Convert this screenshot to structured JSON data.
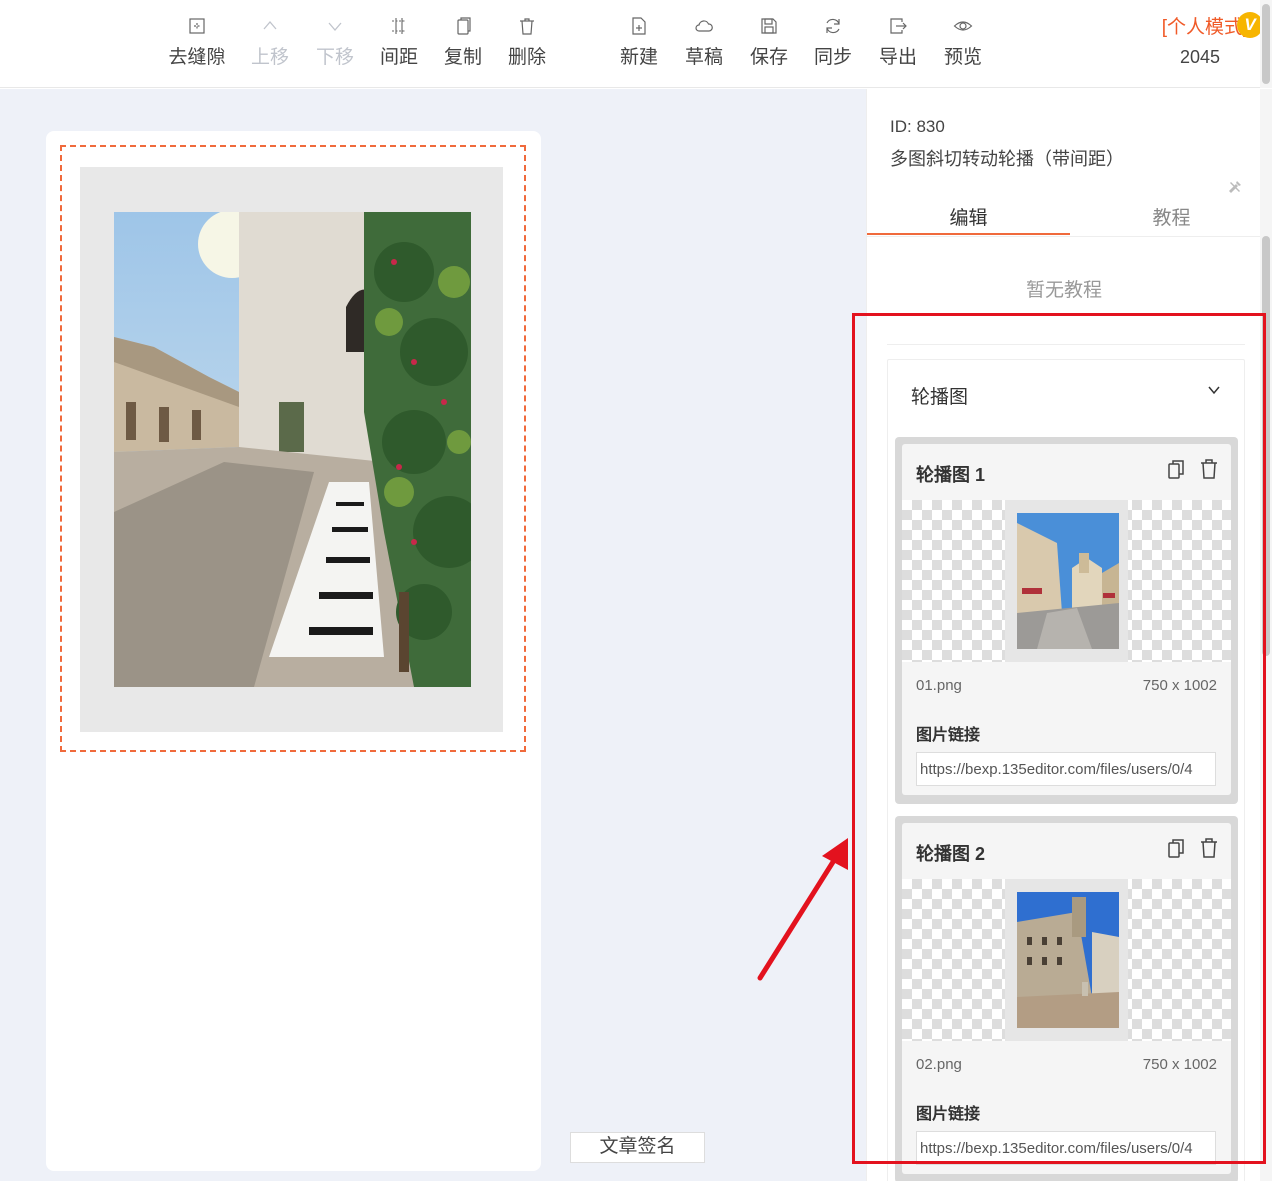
{
  "toolbar": {
    "items": [
      {
        "label": "去缝隙",
        "icon": "gap-icon",
        "enabled": true
      },
      {
        "label": "上移",
        "icon": "chevron-up-icon",
        "enabled": false
      },
      {
        "label": "下移",
        "icon": "chevron-down-icon",
        "enabled": false
      },
      {
        "label": "间距",
        "icon": "spacing-icon",
        "enabled": true
      },
      {
        "label": "复制",
        "icon": "copy-icon",
        "enabled": true
      },
      {
        "label": "删除",
        "icon": "trash-icon",
        "enabled": true
      },
      {
        "label": "新建",
        "icon": "new-file-icon",
        "enabled": true
      },
      {
        "label": "草稿",
        "icon": "cloud-icon",
        "enabled": true
      },
      {
        "label": "保存",
        "icon": "save-icon",
        "enabled": true
      },
      {
        "label": "同步",
        "icon": "sync-icon",
        "enabled": true
      },
      {
        "label": "导出",
        "icon": "export-icon",
        "enabled": true
      },
      {
        "label": "预览",
        "icon": "eye-icon",
        "enabled": true
      }
    ],
    "mode_label": "[个人模式]",
    "vip_badge": "V",
    "mode_count": "2045"
  },
  "document": {
    "signature_button": "文章签名"
  },
  "panel": {
    "id_text": "ID: 830",
    "template_name": "多图斜切转动轮播（带间距）",
    "tabs": [
      {
        "label": "编辑",
        "active": true
      },
      {
        "label": "教程",
        "active": false
      }
    ],
    "no_tutorial": "暂无教程",
    "carousel_group_title": "轮播图",
    "slides": [
      {
        "title": "轮播图 1",
        "file": "01.png",
        "dims": "750 x 1002",
        "link_label": "图片链接",
        "link_value": "https://bexp.135editor.com/files/users/0/4"
      },
      {
        "title": "轮播图 2",
        "file": "02.png",
        "dims": "750 x 1002",
        "link_label": "图片链接",
        "link_value": "https://bexp.135editor.com/files/users/0/4"
      }
    ]
  },
  "colors": {
    "accent": "#f06a3c",
    "annotation_red": "#e3121e",
    "workspace_bg": "#eef1f8",
    "vip_gold": "#f7b500"
  }
}
